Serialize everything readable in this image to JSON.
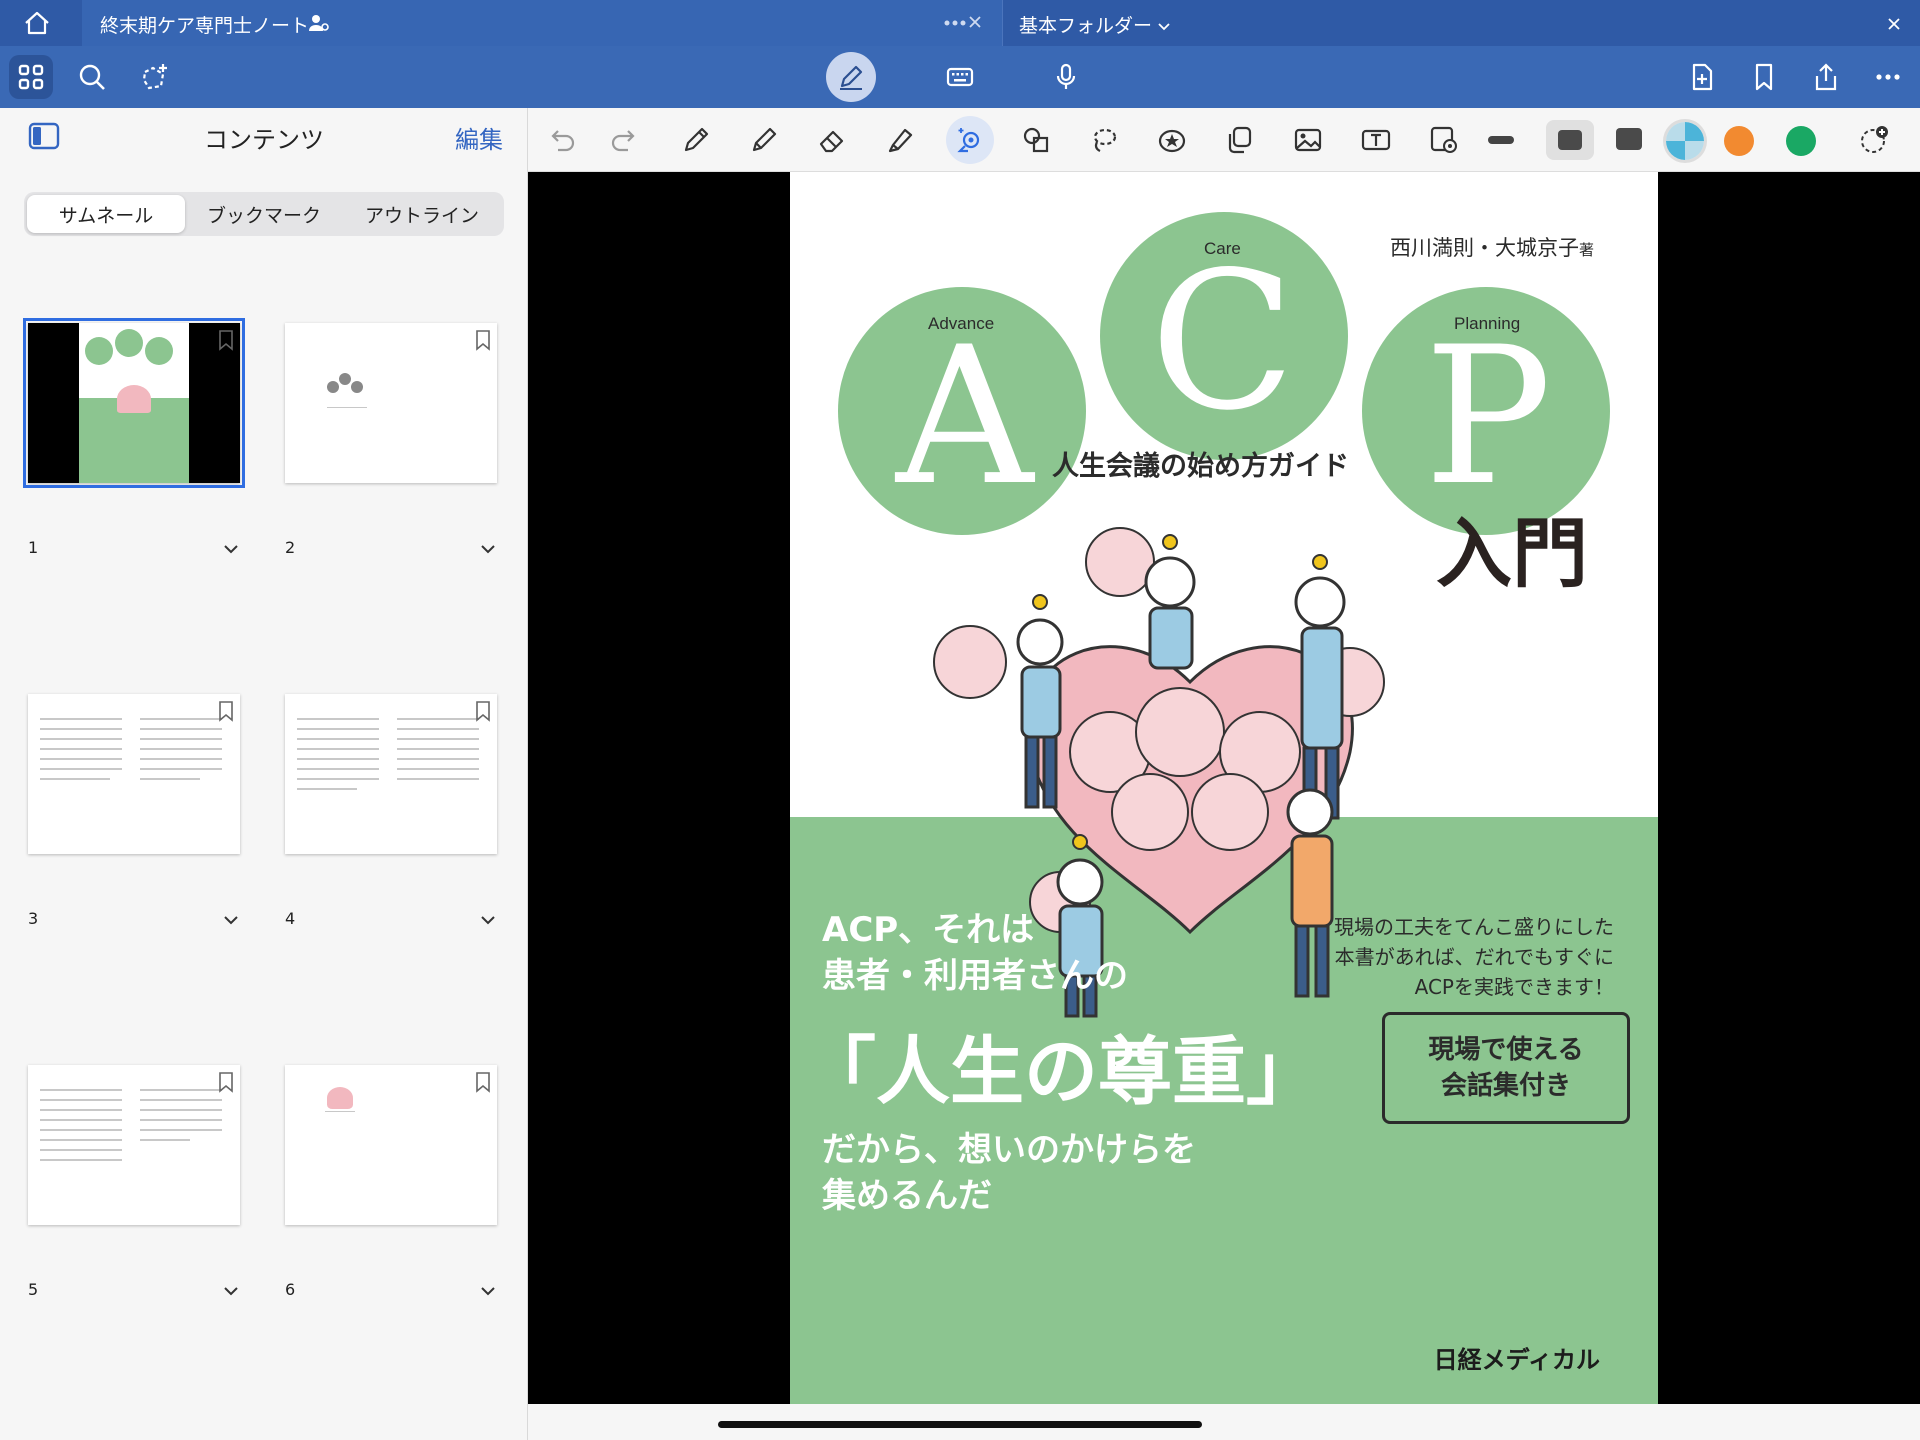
{
  "tabbar": {
    "active_tab_title": "終末期ケア専門士ノート",
    "inactive_tab_title": "基本フォルダー"
  },
  "sidebar": {
    "title": "コンテンツ",
    "edit_label": "編集",
    "segments": [
      "サムネール",
      "ブックマーク",
      "アウトライン"
    ],
    "selected_segment": "サムネール",
    "pages": [
      "1",
      "2",
      "3",
      "4",
      "5",
      "6"
    ]
  },
  "colors": {
    "tabbar": "#2f5aa6",
    "toolbar": "#3a69b5",
    "accent": "#2f6de1",
    "cover_green": "#8cc590",
    "swatch_orange": "#f28a30",
    "swatch_green": "#1aa864",
    "swatch_dark": "#4a4a4a"
  },
  "icons": {
    "toolbar_left": [
      "grid-icon",
      "search-icon",
      "lasso-plus-icon"
    ],
    "toolbar_center": [
      "pen-mode-icon",
      "keyboard-icon",
      "microphone-icon"
    ],
    "toolbar_right": [
      "add-page-icon",
      "bookmark-icon",
      "share-icon",
      "more-icon"
    ],
    "annotation": [
      "undo-icon",
      "redo-icon",
      "pen-icon",
      "pencil-icon",
      "eraser-icon",
      "highlighter-icon",
      "magic-lasso-icon",
      "shapes-icon",
      "lasso-icon",
      "sticker-icon",
      "copy-icon",
      "image-icon",
      "text-box-icon",
      "camera-image-icon"
    ]
  },
  "cover": {
    "author": "西川満則・大城京子",
    "author_suffix": "著",
    "word_advance": "Advance",
    "word_care": "Care",
    "word_planning": "Planning",
    "letter_a": "A",
    "letter_c": "C",
    "letter_p": "P",
    "subtitle": "人生会議の始め方ガイド",
    "title": "入門",
    "lead_line1": "ACP、それは",
    "lead_line2": "患者・利用者さんの",
    "big_quote": "「人生の尊重」",
    "closing_line1": "だから、想いのかけらを",
    "closing_line2": "集めるんだ",
    "side_line1": "現場の工夫をてんこ盛りにした",
    "side_line2": "本書があれば、だれでもすぐに",
    "side_line3": "ACPを実践できます！",
    "box_line1": "現場で使える",
    "box_line2": "会話集付き",
    "publisher": "日経メディカル"
  }
}
